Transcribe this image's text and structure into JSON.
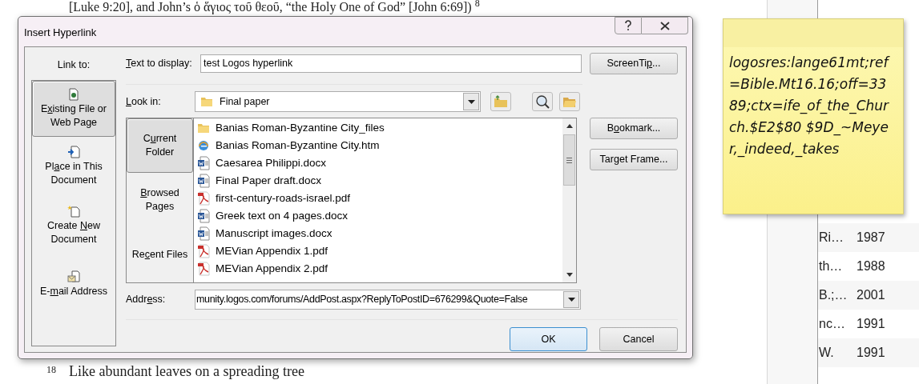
{
  "document": {
    "top_line": "[Luke 9:20], and John’s ὁ ἅγιος τοῦ θεοῦ, “the Holy One of God” [John 6:69]) $^{8}$",
    "footnote_number": "18",
    "footnote_text": "Like abundant leaves on a spreading tree"
  },
  "dialog": {
    "title": "Insert Hyperlink",
    "link_to_label": "Link to:",
    "link_to": [
      {
        "kind": "file",
        "label": {
          "before": "E",
          "key": "x",
          "after": "isting File or Web Page"
        },
        "selected": true
      },
      {
        "kind": "place",
        "label": {
          "before": "Pl",
          "key": "a",
          "after": "ce in This Document"
        },
        "selected": false
      },
      {
        "kind": "new",
        "label": {
          "before": "Create ",
          "key": "N",
          "after": "ew Document"
        },
        "selected": false
      },
      {
        "kind": "email",
        "label": {
          "before": "E-",
          "key": "m",
          "after": "ail Address"
        },
        "selected": false
      }
    ],
    "text_to_display_label": {
      "key": "T",
      "after": "ext to display:"
    },
    "text_to_display": "test Logos hyperlink",
    "screentip_button": {
      "before": "ScreenTi",
      "key": "p",
      "after": "..."
    },
    "look_in_label": {
      "key": "L",
      "after": "ook in:"
    },
    "look_in": "Final paper",
    "sources": [
      {
        "label": {
          "before": "C",
          "key": "u",
          "after": "rrent Folder"
        },
        "selected": true
      },
      {
        "label": {
          "key": "B",
          "after": "rowsed Pages"
        },
        "selected": false
      },
      {
        "label": {
          "before": "Re",
          "key": "c",
          "after": "ent Files"
        },
        "selected": false
      }
    ],
    "files": [
      {
        "kind": "folder",
        "name": "Banias Roman-Byzantine City_files"
      },
      {
        "kind": "web",
        "name": "Banias Roman-Byzantine City.htm"
      },
      {
        "kind": "word",
        "name": "Caesarea Philippi.docx"
      },
      {
        "kind": "word",
        "name": "Final Paper draft.docx"
      },
      {
        "kind": "pdf",
        "name": "first-century-roads-israel.pdf"
      },
      {
        "kind": "word",
        "name": "Greek text on 4 pages.docx"
      },
      {
        "kind": "word",
        "name": "Manuscript images.docx"
      },
      {
        "kind": "pdf",
        "name": "MEVian Appendix 1.pdf"
      },
      {
        "kind": "pdf",
        "name": "MEVian Appendix 2.pdf"
      }
    ],
    "bookmark_button": {
      "before": "B",
      "key": "o",
      "after": "okmark..."
    },
    "target_frame_button": {
      "before": "Tar",
      "key": "g",
      "after": "et Frame..."
    },
    "address_label": {
      "before": "Addr",
      "key": "e",
      "after": "ss:"
    },
    "address": "munity.logos.com/forums/AddPost.aspx?ReplyToPostID=676299&Quote=False",
    "ok_button": "OK",
    "cancel_button": "Cancel"
  },
  "sticky_note": {
    "text": "logosres:lange61mt;ref=Bible.Mt16.16;off=3389;ctx=ife_of_the_Church.$E2$80 $9D_~Meyer,_indeed,_takes"
  },
  "side_table": {
    "rows": [
      {
        "column_1": "Ri…",
        "column_2": "1987"
      },
      {
        "column_1": "th…",
        "column_2": "1988"
      },
      {
        "column_1": "B.;…",
        "column_2": "2001"
      },
      {
        "column_1": "nc…",
        "column_2": "1991"
      },
      {
        "column_1": "W.",
        "column_2": "1991"
      }
    ]
  }
}
